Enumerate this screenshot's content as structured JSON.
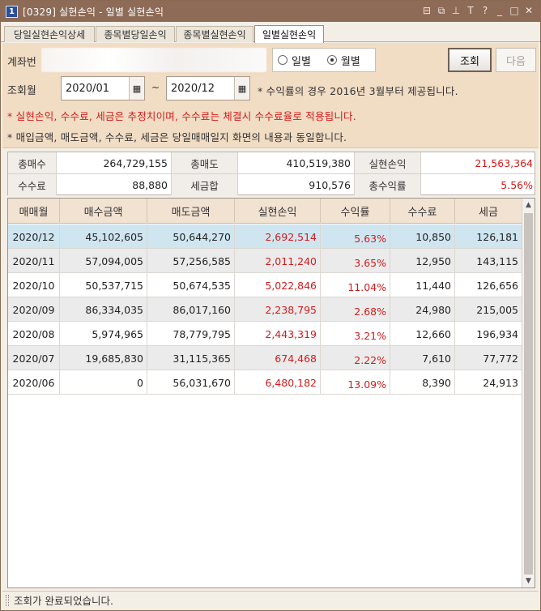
{
  "window": {
    "screen_no": "1",
    "title": "[0329] 실현손익 - 일별 실현손익",
    "icons": [
      "layout-icon",
      "copy-window-icon",
      "pin-icon",
      "font-size-icon",
      "help-icon",
      "minimize-icon",
      "maximize-icon",
      "close-icon"
    ],
    "icon_glyphs": [
      "⊟",
      "⧉",
      "⊥",
      "T",
      "?",
      "_",
      "□",
      "✕"
    ]
  },
  "tabs": [
    {
      "label": "당일실현손익상세",
      "active": false
    },
    {
      "label": "종목별당일손익",
      "active": false
    },
    {
      "label": "종목별실현손익",
      "active": false
    },
    {
      "label": "일별실현손익",
      "active": true
    }
  ],
  "form": {
    "account_label": "계좌번",
    "radio_daily": "일별",
    "radio_monthly": "월별",
    "selected_period": "월별",
    "query_button": "조회",
    "next_button": "다음",
    "period_label": "조회월",
    "from_date": "2020/01",
    "to_date": "2020/12",
    "tilde": "~",
    "notice_1": "* 수익률의 경우 2016년 3월부터 제공됩니다.",
    "notice_2": "* 실현손익, 수수료, 세금은 추정치이며, 수수료는 체결시 수수료율로 적용됩니다.",
    "notice_3": "* 매입금액, 매도금액, 수수료, 세금은 당일매매일지 화면의 내용과 동일합니다.",
    "accent_red": "#d21b1b"
  },
  "summary": {
    "total_buy_label": "총매수",
    "total_buy": "264,729,155",
    "total_sell_label": "총매도",
    "total_sell": "410,519,380",
    "realized_label": "실현손익",
    "realized": "21,563,364",
    "fee_label": "수수료",
    "fee": "88,880",
    "tax_label": "세금합",
    "tax": "910,576",
    "total_rate_label": "총수익률",
    "total_rate": "5.56%"
  },
  "grid": {
    "columns": [
      "매매월",
      "매수금액",
      "매도금액",
      "실현손익",
      "수익률",
      "수수료",
      "세금"
    ],
    "rows": [
      {
        "month": "2020/12",
        "buy": "45,102,605",
        "sell": "50,644,270",
        "pnl": "2,692,514",
        "rate": "5.63%",
        "fee": "10,850",
        "tax": "126,181",
        "selected": true
      },
      {
        "month": "2020/11",
        "buy": "57,094,005",
        "sell": "57,256,585",
        "pnl": "2,011,240",
        "rate": "3.65%",
        "fee": "12,950",
        "tax": "143,115",
        "selected": false
      },
      {
        "month": "2020/10",
        "buy": "50,537,715",
        "sell": "50,674,535",
        "pnl": "5,022,846",
        "rate": "11.04%",
        "fee": "11,440",
        "tax": "126,656",
        "selected": false
      },
      {
        "month": "2020/09",
        "buy": "86,334,035",
        "sell": "86,017,160",
        "pnl": "2,238,795",
        "rate": "2.68%",
        "fee": "24,980",
        "tax": "215,005",
        "selected": false
      },
      {
        "month": "2020/08",
        "buy": "5,974,965",
        "sell": "78,779,795",
        "pnl": "2,443,319",
        "rate": "3.21%",
        "fee": "12,660",
        "tax": "196,934",
        "selected": false
      },
      {
        "month": "2020/07",
        "buy": "19,685,830",
        "sell": "31,115,365",
        "pnl": "674,468",
        "rate": "2.22%",
        "fee": "7,610",
        "tax": "77,772",
        "selected": false
      },
      {
        "month": "2020/06",
        "buy": "0",
        "sell": "56,031,670",
        "pnl": "6,480,182",
        "rate": "13.09%",
        "fee": "8,390",
        "tax": "24,913",
        "selected": false
      }
    ],
    "scroll_up": "▲",
    "scroll_down": "▼"
  },
  "status": {
    "message": "조회가 완료되었습니다."
  },
  "colors": {
    "titlebar": "#8e6b57",
    "form_bg": "#f1dcc4",
    "grid_header": "#f2e2d2",
    "selected_row": "#cfe6f1",
    "alt_row": "#ebebeb"
  }
}
